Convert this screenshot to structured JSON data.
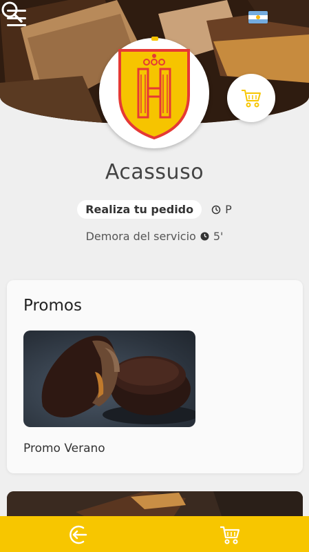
{
  "header": {
    "menu_icon": "hamburger-icon",
    "flag_icon": "argentina-flag-icon",
    "search_icon": "search-icon"
  },
  "brand": {
    "logo_icon": "havanna-h-crest-logo",
    "logo_color": "#f6c400",
    "logo_border": "#e53935"
  },
  "cart": {
    "icon": "cart-icon",
    "color": "#f7c600"
  },
  "store": {
    "name": "Acassuso",
    "order_label": "Realiza tu pedido",
    "status_icon": "clock-icon",
    "status_text": "P",
    "delay_label": "Demora del servicio",
    "delay_icon": "clock-icon",
    "delay_value": "5'"
  },
  "promos": {
    "title": "Promos",
    "items": [
      {
        "name": "Promo Verano",
        "image": "chocolate-alfajores-photo"
      }
    ]
  },
  "bottom_nav": {
    "background": "#f7c600",
    "items": [
      {
        "icon": "logout-icon"
      },
      {
        "icon": "cart-icon"
      }
    ]
  }
}
